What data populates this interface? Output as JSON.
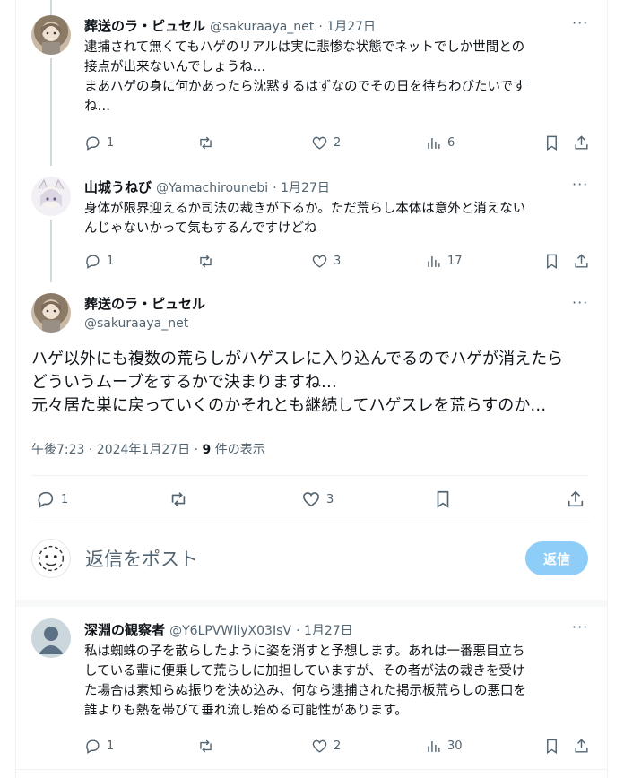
{
  "posts": [
    {
      "name": "葬送のラ・ピュセル",
      "handle": "@sakuraaya_net",
      "date": "1月27日",
      "text": "逮捕されて無くてもハゲのリアルは実に悲惨な状態でネットでしか世間との\n接点が出来ないんでしょうね…\nまあハゲの身に何かあったら沈黙するはずなのでその日を待ちわびたいです\nね…",
      "replies": "1",
      "reposts": "",
      "likes": "2",
      "views": "6"
    },
    {
      "name": "山城うねび",
      "handle": "@Yamachirounebi",
      "date": "1月27日",
      "text": "身体が限界迎えるか司法の裁きが下るか。ただ荒らし本体は意外と消えない\nんじゃないかって気もするんですけどね",
      "replies": "1",
      "reposts": "",
      "likes": "3",
      "views": "17"
    }
  ],
  "main_post": {
    "name": "葬送のラ・ピュセル",
    "handle": "@sakuraaya_net",
    "text": "ハゲ以外にも複数の荒らしがハゲスレに入り込んでるのでハゲが消えたら\nどういうムーブをするかで決まりますね…\n元々居た巣に戻っていくのかそれとも継続してハゲスレを荒らすのか…",
    "time": "午後7:23 · 2024年1月27日 · ",
    "views_count": "9",
    "views_label": " 件の表示",
    "replies": "1",
    "reposts": "",
    "likes": "3"
  },
  "composer": {
    "placeholder": "返信をポスト",
    "button": "返信"
  },
  "reply_post": {
    "name": "深淵の観察者",
    "handle": "@Y6LPVWIiyX03IsV",
    "date": "1月27日",
    "text": "私は蜘蛛の子を散らしたように姿を消すと予想します。あれは一番悪目立ち\nしている輩に便乗して荒らしに加担していますが、その者が法の裁きを受け\nた場合は素知らぬ振りを決め込み、何なら逮捕された掲示板荒らしの悪口を\n誰よりも熱を帯びて垂れ流し始める可能性があります。",
    "replies": "1",
    "reposts": "",
    "likes": "2",
    "views": "30"
  },
  "colors": {
    "accent_disabled": "#8ecdf8",
    "text": "#0f1419",
    "muted": "#536471",
    "divider": "#eff3f4"
  },
  "icons": [
    "reply-icon",
    "repost-icon",
    "like-icon",
    "views-icon",
    "bookmark-icon",
    "share-icon",
    "more-icon"
  ]
}
